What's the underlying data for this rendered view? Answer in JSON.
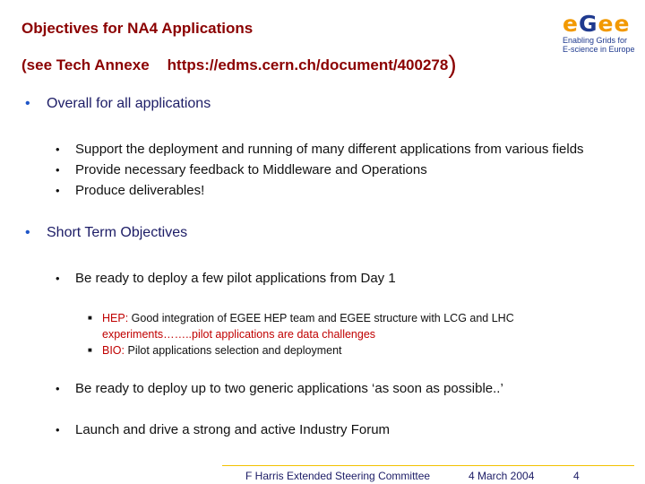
{
  "title": {
    "line1": "Objectives for NA4 Applications",
    "line2_left": "(see Tech Annexe",
    "line2_url": "https://edms.cern.ch/document/400278",
    "line2_paren": ")"
  },
  "logo": {
    "mark_e1": "e",
    "mark_g": "G",
    "mark_e2": "e",
    "mark_e3": "e",
    "tag_line1": "Enabling Grids for",
    "tag_line2": "E-science in Europe",
    "colors": {
      "orange": "#f29900",
      "blue": "#1f3a8f"
    }
  },
  "sections": [
    {
      "heading": "Overall for all applications",
      "items": [
        "Support the deployment and running of  many different applications from various fields",
        "Provide necessary feedback to Middleware  and Operations",
        "Produce deliverables!"
      ]
    },
    {
      "heading": "Short Term Objectives",
      "items": [
        "Be ready to deploy a few pilot applications from Day 1",
        "Be ready to deploy up to two generic applications ‘as soon as possible..’",
        "Launch  and drive a strong and active Industry Forum"
      ],
      "subitems": {
        "hep_label": "HEP:",
        "hep_text_line1": " Good integration of EGEE HEP team and EGEE structure with LCG and LHC",
        "hep_text_line2": "experiments……..pilot applications are data challenges",
        "bio_label": "BIO:",
        "bio_text": " Pilot applications selection and deployment"
      }
    }
  ],
  "footer": {
    "author": "F Harris   Extended Steering Committee",
    "date": "4 March 2004",
    "page": "4"
  }
}
